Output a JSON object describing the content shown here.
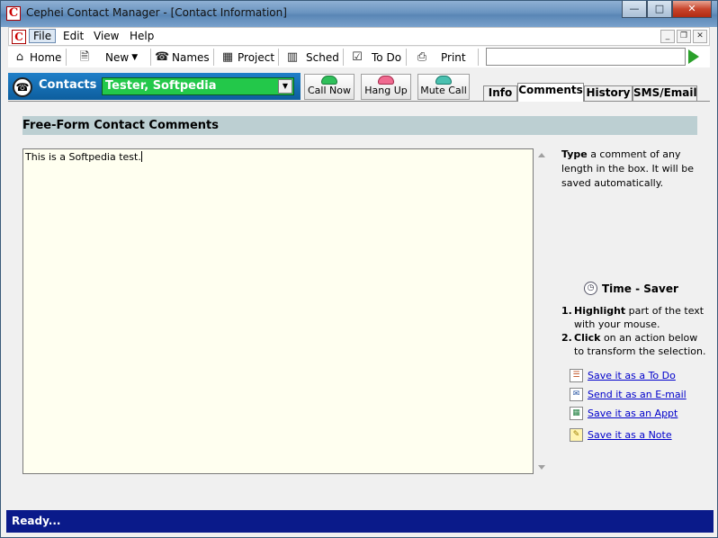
{
  "window": {
    "title": "Cephei Contact Manager - [Contact Information]",
    "minimize_glyph": "—",
    "maximize_glyph": "□",
    "close_glyph": "✕"
  },
  "menu": {
    "items": [
      "File",
      "Edit",
      "View",
      "Help"
    ]
  },
  "toolbar": {
    "home": "Home",
    "new": "New",
    "names": "Names",
    "project": "Project",
    "sched": "Sched",
    "todo": "To Do",
    "print": "Print",
    "search_value": ""
  },
  "contacts": {
    "label": "Contacts :",
    "selected": "Tester, Softpedia",
    "call_now": "Call Now",
    "hang_up": "Hang Up",
    "mute_call": "Mute Call"
  },
  "tabs": [
    {
      "label": "Info",
      "active": false
    },
    {
      "label": "Comments",
      "active": true
    },
    {
      "label": "History",
      "active": false
    },
    {
      "label": "SMS/Email",
      "active": false
    }
  ],
  "comments": {
    "header": "Free-Form Contact Comments",
    "text": "This is a Softpedia test."
  },
  "help": {
    "type_bold": "Type",
    "type_text": " a comment of any length in the box. It will be saved automatically.",
    "time_saver": "Time - Saver",
    "step1_num": "1.",
    "step1_bold": "Highlight",
    "step1_text": " part of the text with your mouse.",
    "step2_num": "2.",
    "step2_bold": "Click",
    "step2_text": " on an action below to transform the selection.",
    "actions": [
      "Save it as a To Do",
      "Send it as an E-mail",
      "Save it as an Appt",
      "Save it as a Note"
    ]
  },
  "status": {
    "text": "Ready..."
  }
}
